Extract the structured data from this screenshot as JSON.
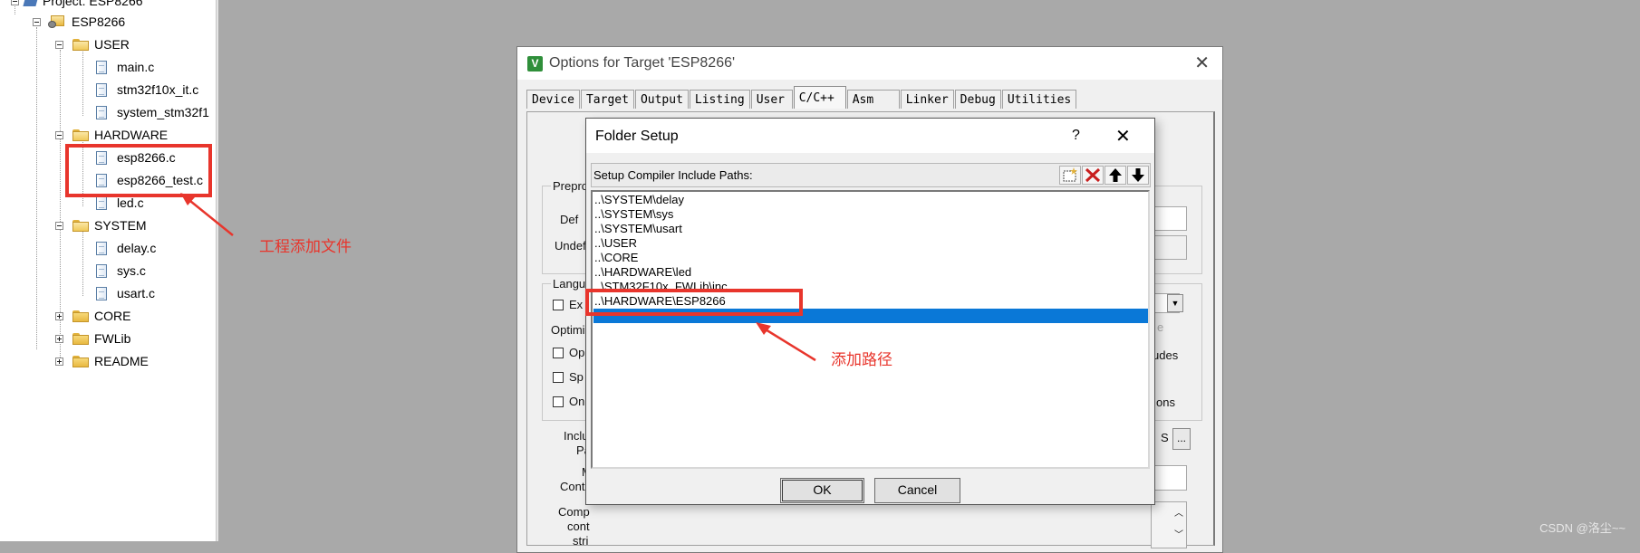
{
  "project_tree": {
    "project_label": "Project: ESP8266",
    "target_label": "ESP8266",
    "groups": [
      {
        "label": "USER",
        "expanded": true,
        "files": [
          "main.c",
          "stm32f10x_it.c",
          "system_stm32f1"
        ]
      },
      {
        "label": "HARDWARE",
        "expanded": true,
        "files": [
          "esp8266.c",
          "esp8266_test.c",
          "led.c"
        ]
      },
      {
        "label": "SYSTEM",
        "expanded": true,
        "files": [
          "delay.c",
          "sys.c",
          "usart.c"
        ]
      },
      {
        "label": "CORE",
        "expanded": false,
        "files": []
      },
      {
        "label": "FWLib",
        "expanded": false,
        "files": []
      },
      {
        "label": "README",
        "expanded": false,
        "files": []
      }
    ]
  },
  "annotations": {
    "files_note": "工程添加文件",
    "path_note": "添加路径",
    "color": "#e8352c"
  },
  "options_dialog": {
    "logo": "V",
    "title": "Options for Target 'ESP8266'",
    "close": "✕",
    "tabs": [
      "Device",
      "Target",
      "Output",
      "Listing",
      "User",
      "C/C++",
      "Asm",
      "Linker",
      "Debug",
      "Utilities"
    ],
    "active_tab": "C/C++",
    "fragments": {
      "prepro": "Preproc",
      "define": "Def",
      "undefine": "Undef",
      "language": "Langu",
      "ex": "Ex",
      "optimiz": "Optimiz",
      "op": "Op",
      "sp": "Sp",
      "on": "On",
      "includes": "udes",
      "ons": "ons",
      "include_paths_1": "Inclu",
      "include_paths_2": "Pat",
      "misc_1": "M",
      "misc_2": "Contr",
      "compiler_1": "Comp",
      "compiler_2": "cont",
      "compiler_3": "stri",
      "browse": "...",
      "s_char": "S",
      "e_char": "e"
    }
  },
  "folder_dialog": {
    "title": "Folder Setup",
    "help": "?",
    "close": "✕",
    "header": "Setup Compiler Include Paths:",
    "toolbar": {
      "new": "new-folder-icon",
      "delete": "delete-icon",
      "up": "move-up-icon",
      "down": "move-down-icon"
    },
    "paths": [
      "..\\SYSTEM\\delay",
      "..\\SYSTEM\\sys",
      "..\\SYSTEM\\usart",
      "..\\USER",
      "..\\CORE",
      "..\\HARDWARE\\led",
      "..\\STM32F10x_FWLib\\inc",
      "..\\HARDWARE\\ESP8266"
    ],
    "ok_label": "OK",
    "cancel_label": "Cancel",
    "selection_color": "#0a78d7"
  },
  "watermark": "CSDN @洛尘~~"
}
